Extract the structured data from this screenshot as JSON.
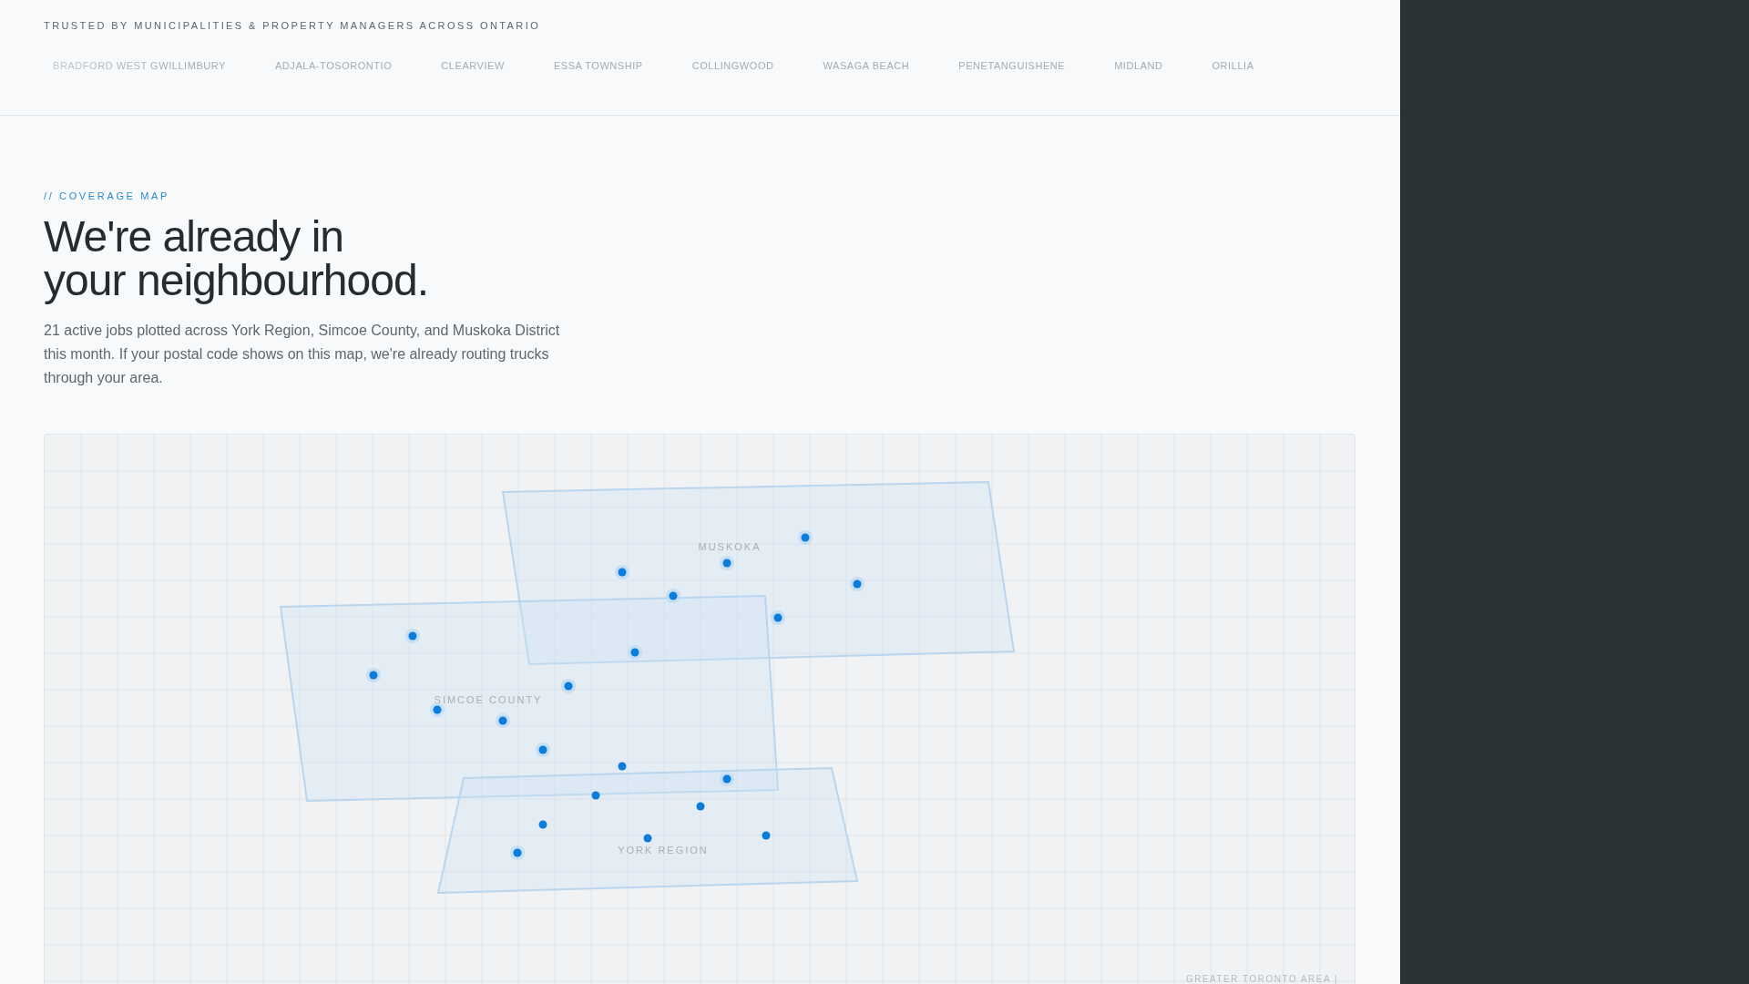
{
  "trust_bar": {
    "title": "TRUSTED BY MUNICIPALITIES & PROPERTY MANAGERS ACROSS ONTARIO",
    "clients": [
      "BRADFORD WEST GWILLIMBURY",
      "ADJALA-TOSORONTIO",
      "CLEARVIEW",
      "ESSA TOWNSHIP",
      "COLLINGWOOD",
      "WASAGA BEACH",
      "PENETANGUISHENE",
      "MIDLAND",
      "ORILLIA"
    ]
  },
  "coverage": {
    "eyebrow": "// COVERAGE MAP",
    "heading_lines": [
      "We're already in",
      "your neighbourhood."
    ],
    "description": "21 active jobs plotted across York Region, Simcoe County, and Muskoka District this month. If your postal code shows on this map, we're already routing trucks through your area.",
    "map": {
      "regions": [
        {
          "name": "MUSKOKA"
        },
        {
          "name": "SIMCOE COUNTY"
        },
        {
          "name": "YORK REGION"
        }
      ],
      "corner_label": "GREATER TORONTO AREA |"
    }
  }
}
